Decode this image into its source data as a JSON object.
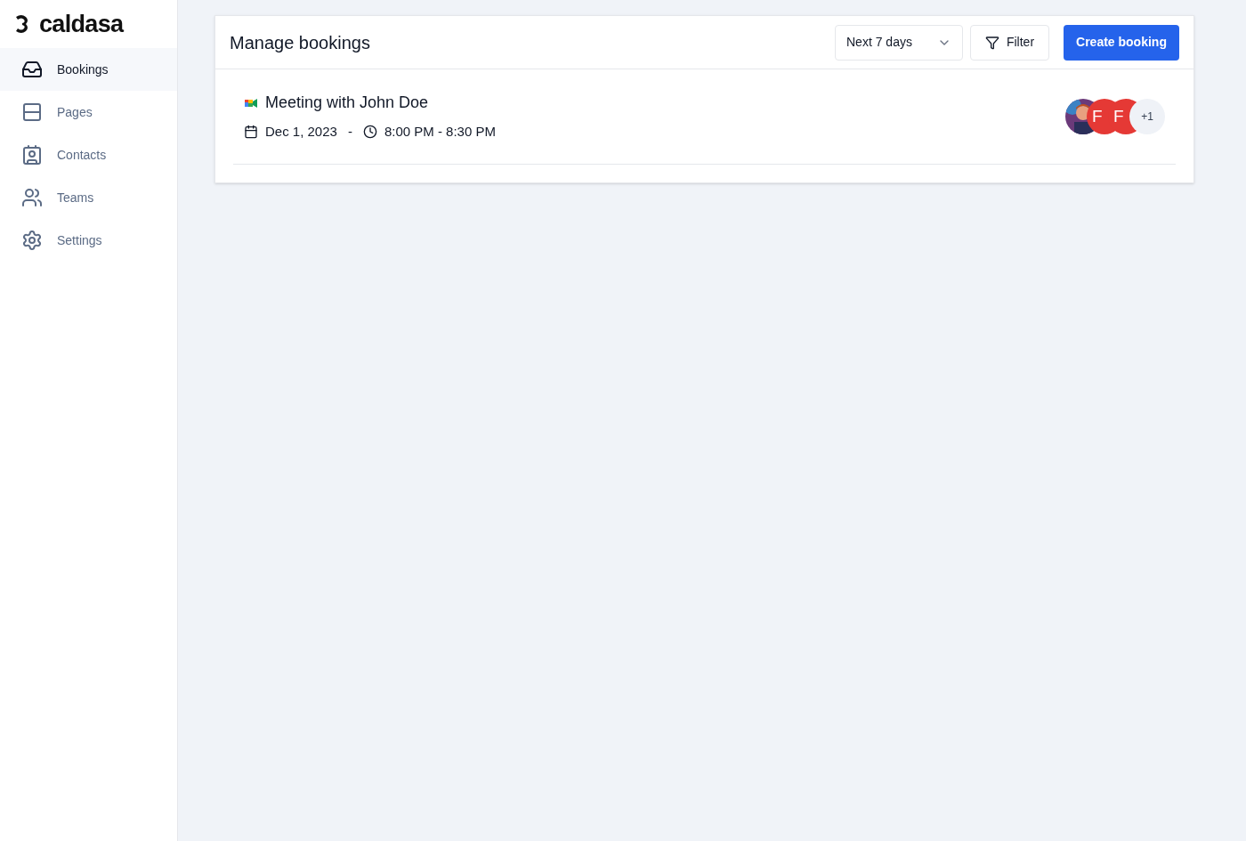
{
  "logo": {
    "text": "caldasa"
  },
  "sidebar": {
    "items": [
      {
        "label": "Bookings",
        "selected": true
      },
      {
        "label": "Pages",
        "selected": false
      },
      {
        "label": "Contacts",
        "selected": false
      },
      {
        "label": "Teams",
        "selected": false
      },
      {
        "label": "Settings",
        "selected": false
      }
    ]
  },
  "header": {
    "title": "Manage bookings",
    "range_select": {
      "value": "Next 7 days"
    },
    "filter_button": "Filter",
    "create_button": "Create booking"
  },
  "bookings": [
    {
      "title": "Meeting with John Doe",
      "date": "Dec 1, 2023",
      "separator": "-",
      "time": "8:00 PM - 8:30 PM",
      "attendees": [
        {
          "kind": "picture"
        },
        {
          "kind": "initials",
          "initials": "F",
          "color": "#e53935"
        },
        {
          "kind": "initials",
          "initials": "F",
          "color": "#e53935"
        },
        {
          "kind": "more",
          "text": "+1"
        }
      ]
    }
  ]
}
